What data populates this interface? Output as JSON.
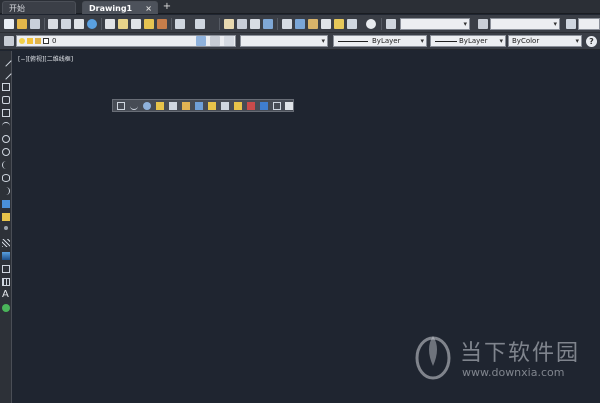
{
  "tabs": {
    "home_label": "开始",
    "drawing_label": "Drawing1",
    "close_glyph": "×",
    "add_glyph": "+"
  },
  "properties_bar": {
    "layer_value": "0",
    "linetype_value": "ByLayer",
    "lineweight_value": "ByLayer",
    "color_value": "ByColor",
    "help_glyph": "?"
  },
  "viewport": {
    "label": "[−][俯视][二维线框]"
  },
  "left_toolbar": {
    "text_tool_glyph": "A"
  },
  "watermark": {
    "brand": "当下软件园",
    "url": "www.downxia.com"
  },
  "colors": {
    "canvas": "#1f2530",
    "toolbar": "#3a3e46",
    "accent_blue": "#4a90d9",
    "accent_yellow": "#e8c44a"
  }
}
